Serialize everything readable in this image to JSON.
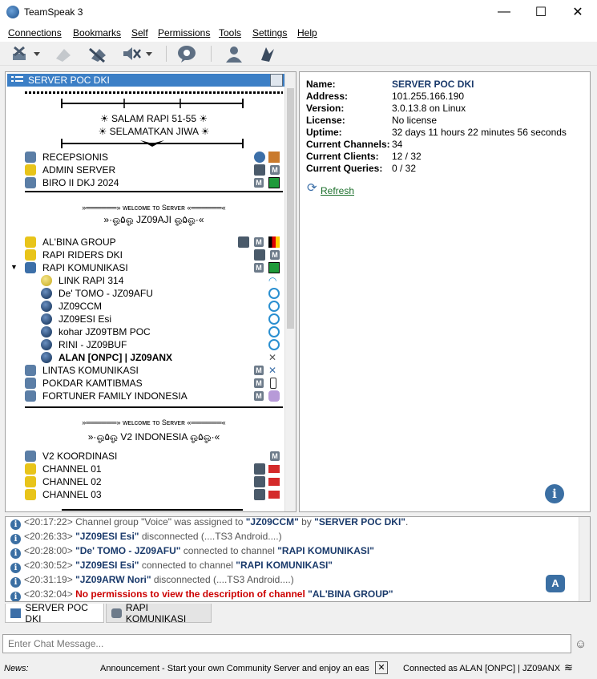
{
  "window": {
    "title": "TeamSpeak 3",
    "minimize": "—",
    "maximize": "☐",
    "close": "✕"
  },
  "menu": [
    "Connections",
    "Bookmarks",
    "Self",
    "Permissions",
    "Tools",
    "Settings",
    "Help"
  ],
  "tree": {
    "server_name": "SERVER POC DKI",
    "spacer1": {
      "line1": "☀ SALAM RAPI 51-55 ☀",
      "line2": "☀ SELAMATKAN JIWA ☀"
    },
    "channels_a": [
      "RECEPSIONIS",
      "ADMIN SERVER",
      "BIRO II DKJ 2024"
    ],
    "spacer2": {
      "welcome": "»══════» ᴡᴇʟᴄᴏᴍᴇ ᴛᴏ Sᴇʀᴠᴇʀ «══════«",
      "name": "»·ஓ۵ஓ JZ09AJI ஓ۵ஓ·«"
    },
    "channels_b": [
      "AL'BINA GROUP",
      "RAPI RIDERS DKI",
      "RAPI KOMUNIKASI"
    ],
    "clients": [
      "LINK RAPI 314",
      "De' TOMO - JZ09AFU",
      "JZ09CCM",
      "JZ09ESI Esi",
      "kohar JZ09TBM POC",
      "RINI - JZ09BUF",
      "ALAN [ONPC] | JZ09ANX"
    ],
    "channels_c": [
      "LINTAS KOMUNIKASI",
      "POKDAR KAMTIBMAS",
      "FORTUNER FAMILY INDONESIA"
    ],
    "spacer3": {
      "welcome": "»══════» ᴡᴇʟᴄᴏᴍᴇ ᴛᴏ Sᴇʀᴠᴇʀ «══════«",
      "name": "»·ஓ۵ஓ V2 INDONESIA ஓ۵ஓ·«"
    },
    "channels_d": [
      "V2 KOORDINASI",
      "CHANNEL 01",
      "CHANNEL 02",
      "CHANNEL 03"
    ]
  },
  "info": {
    "labels": {
      "name": "Name:",
      "address": "Address:",
      "version": "Version:",
      "license": "License:",
      "uptime": "Uptime:",
      "channels": "Current Channels:",
      "clients": "Current Clients:",
      "queries": "Current Queries:"
    },
    "name": "SERVER POC DKI",
    "address": "101.255.166.190",
    "version": "3.0.13.8 on Linux",
    "license": "No license",
    "uptime": "32 days 11 hours 22 minutes 56 seconds",
    "channels": "34",
    "clients": "12 / 32",
    "queries": "0 / 32",
    "refresh": "Refresh"
  },
  "log": [
    {
      "time": "<20:17:22>",
      "a": " Channel group \"Voice\" was assigned to ",
      "b": "\"JZ09CCM\"",
      "c": " by ",
      "d": "\"SERVER POC DKI\"",
      "e": "."
    },
    {
      "time": "<20:26:33>",
      "a": " ",
      "b": "\"JZ09ESI Esi\"",
      "c": " disconnected (....TS3 Android....)",
      "d": "",
      "e": ""
    },
    {
      "time": "<20:28:00>",
      "a": " ",
      "b": "\"De' TOMO - JZ09AFU\"",
      "c": " connected to channel ",
      "d": "\"RAPI KOMUNIKASI\"",
      "e": ""
    },
    {
      "time": "<20:30:52>",
      "a": " ",
      "b": "\"JZ09ESI Esi\"",
      "c": " connected to channel ",
      "d": "\"RAPI KOMUNIKASI\"",
      "e": ""
    },
    {
      "time": "<20:31:19>",
      "a": " ",
      "b": "\"JZ09ARW Nori\"",
      "c": " disconnected (....TS3 Android....)",
      "d": "",
      "e": ""
    },
    {
      "time": "<20:32:04>",
      "a": " ",
      "err": "No permissions to view the description of channel",
      "d": " \"AL'BINA GROUP\""
    }
  ],
  "tabs": [
    "SERVER POC DKI",
    "RAPI KOMUNIKASI"
  ],
  "chat": {
    "placeholder": "Enter Chat Message..."
  },
  "status": {
    "news_label": "News:",
    "news": "Announcement - Start your own Community Server and enjoy an easy",
    "connected": "Connected as ALAN [ONPC] | JZ09ANX"
  },
  "colors": {
    "selection": "#3c7fc6",
    "link": "#1a6e2a",
    "error": "#cc0000",
    "name_blue": "#1a3a6b"
  }
}
